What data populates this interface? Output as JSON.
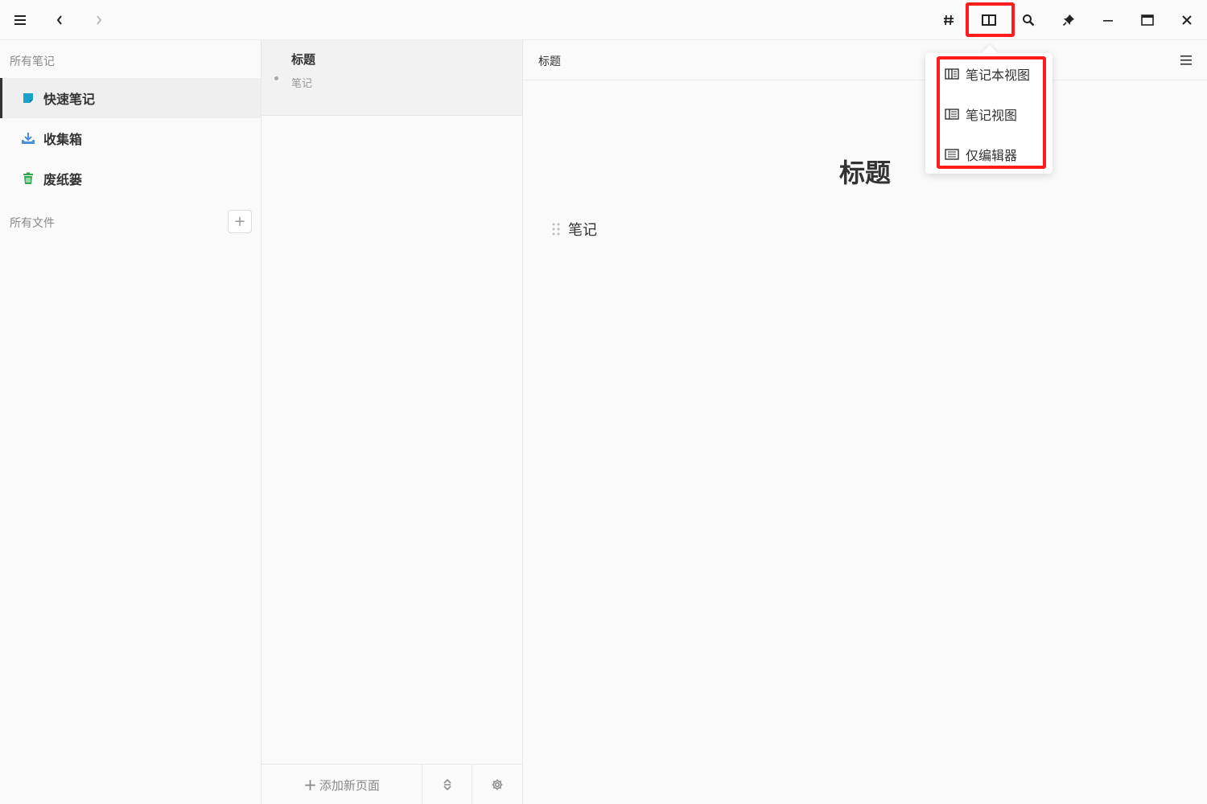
{
  "sidebar": {
    "all_notes_title": "所有笔记",
    "items": [
      {
        "label": "快速笔记",
        "icon": "quick-note-icon",
        "color": "#1aa3c8"
      },
      {
        "label": "收集箱",
        "icon": "inbox-icon",
        "color": "#4a8fd8"
      },
      {
        "label": "废纸篓",
        "icon": "trash-icon",
        "color": "#2fa84f"
      }
    ],
    "all_files_title": "所有文件",
    "add_label": "+"
  },
  "notelist": {
    "note": {
      "title": "标题",
      "snippet": "笔记"
    },
    "add_page_label": "添加新页面"
  },
  "editor": {
    "breadcrumb": "标题",
    "title": "标题",
    "body": "笔记"
  },
  "view_menu": {
    "items": [
      {
        "label": "笔记本视图",
        "icon": "notebook-view-icon"
      },
      {
        "label": "笔记视图",
        "icon": "note-view-icon"
      },
      {
        "label": "仅编辑器",
        "icon": "editor-only-icon"
      }
    ]
  },
  "colors": {
    "highlight": "#ff1c1c"
  }
}
